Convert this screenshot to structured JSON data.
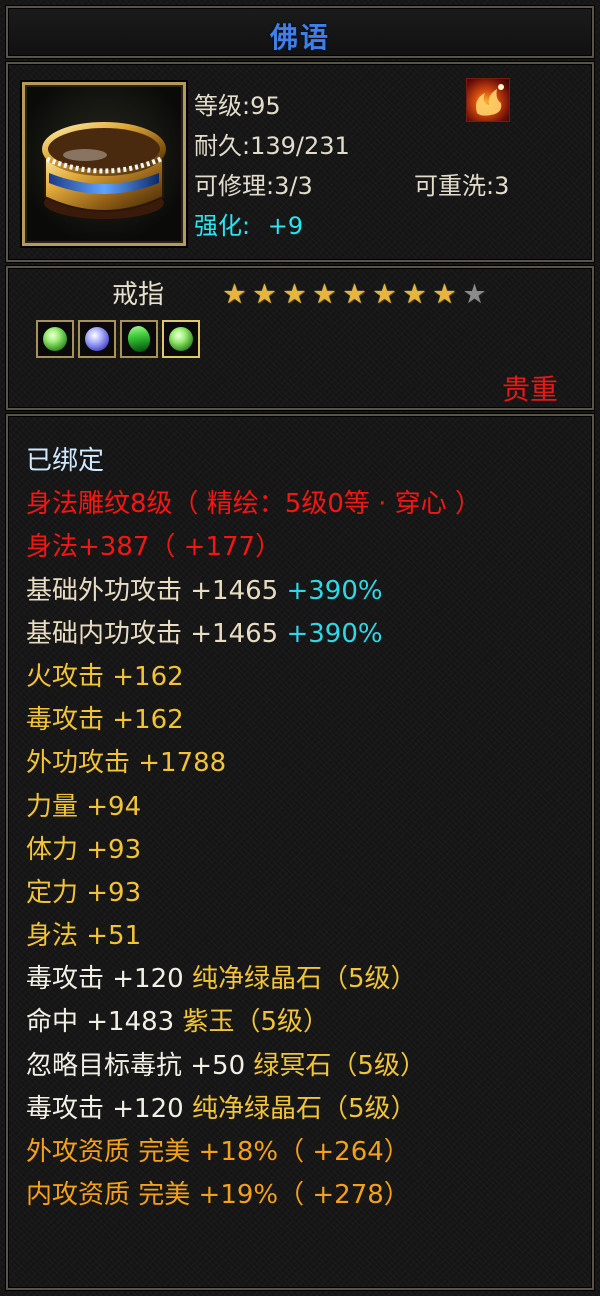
{
  "title": "佛语",
  "header": {
    "level": "等级:95",
    "durability": "耐久:139/231",
    "repairable": "可修理:3/3",
    "rewashable": "可重洗:3",
    "enhance_label": "强化:",
    "enhance_value": "+9",
    "icon": "gold-ring-icon",
    "badge_icon": "phoenix-flame-icon"
  },
  "item": {
    "name": "戒指",
    "stars_total": 9,
    "stars_filled": 8,
    "gems": [
      {
        "icon": "green-gem-icon"
      },
      {
        "icon": "purple-jade-icon"
      },
      {
        "icon": "green-crystal-icon"
      },
      {
        "icon": "green-gem-icon"
      }
    ],
    "rarity": "贵重"
  },
  "attributes": [
    {
      "text": "已绑定",
      "extra": "",
      "color": "cyan-light"
    },
    {
      "text": "身法雕纹8级（ 精绘：5级0等 · 穿心 ）",
      "extra": "",
      "color": "red"
    },
    {
      "text": "身法+387（ +177）",
      "extra": "",
      "color": "red"
    },
    {
      "text": "基础外功攻击 +1465 ",
      "extra": "+390%",
      "color": "beige"
    },
    {
      "text": "基础内功攻击 +1465 ",
      "extra": "+390%",
      "color": "beige"
    },
    {
      "text": "火攻击 +162",
      "extra": "",
      "color": "yellow"
    },
    {
      "text": "毒攻击 +162",
      "extra": "",
      "color": "yellow"
    },
    {
      "text": "外功攻击 +1788",
      "extra": "",
      "color": "yellow"
    },
    {
      "text": "力量 +94",
      "extra": "",
      "color": "yellow"
    },
    {
      "text": "体力 +93",
      "extra": "",
      "color": "yellow"
    },
    {
      "text": "定力 +93",
      "extra": "",
      "color": "yellow"
    },
    {
      "text": "身法 +51",
      "extra": "",
      "color": "yellow"
    },
    {
      "text": "毒攻击 +120 ",
      "extra": "纯净绿晶石（5级）",
      "color": "white"
    },
    {
      "text": "命中 +1483 ",
      "extra": "紫玉（5级）",
      "color": "white"
    },
    {
      "text": "忽略目标毒抗 +50 ",
      "extra": "绿冥石（5级）",
      "color": "white"
    },
    {
      "text": "毒攻击 +120 ",
      "extra": "纯净绿晶石（5级）",
      "color": "white"
    },
    {
      "text": "外攻资质  完美 +18%（ +264）",
      "extra": "",
      "color": "orange"
    },
    {
      "text": "内攻资质  完美 +19%（ +278）",
      "extra": "",
      "color": "orange"
    }
  ]
}
